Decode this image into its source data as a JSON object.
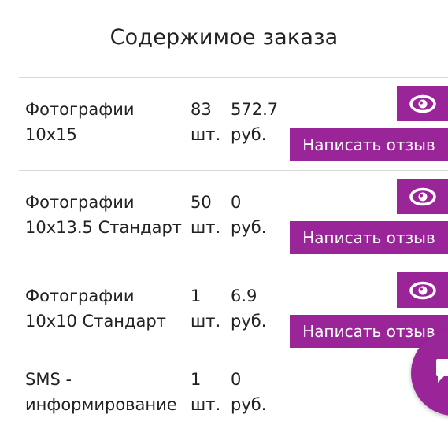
{
  "title": "Содержимое заказа",
  "colors": {
    "accent": "#9a2599",
    "divider": "#d9d9d9",
    "text": "#222222"
  },
  "rows": [
    {
      "name_line1": "Фотографии",
      "name_line2": "10x15",
      "qty_value": "83",
      "qty_unit": "шт.",
      "price_value": "572.7",
      "price_unit": "руб.",
      "view_icon": "eye-icon",
      "review_label": "Написать отзыв"
    },
    {
      "name_line1": "Фотографии",
      "name_line2": "10x13.5 Стандарт",
      "qty_value": "50",
      "qty_unit": "шт.",
      "price_value": "0",
      "price_unit": "руб.",
      "view_icon": "eye-icon",
      "review_label": "Написать отзыв"
    },
    {
      "name_line1": "Фотографии",
      "name_line2": "10x10 Стандарт",
      "qty_value": "1",
      "qty_unit": "шт.",
      "price_value": "6.9",
      "price_unit": "руб.",
      "view_icon": "eye-icon",
      "review_label": "Написать отзыв"
    },
    {
      "name_line1": "SMS -",
      "name_line2": "информирование",
      "qty_value": "1",
      "qty_unit": "шт.",
      "price_value": "0",
      "price_unit": "руб."
    }
  ],
  "chat_button": {
    "icon": "chat-icon"
  }
}
